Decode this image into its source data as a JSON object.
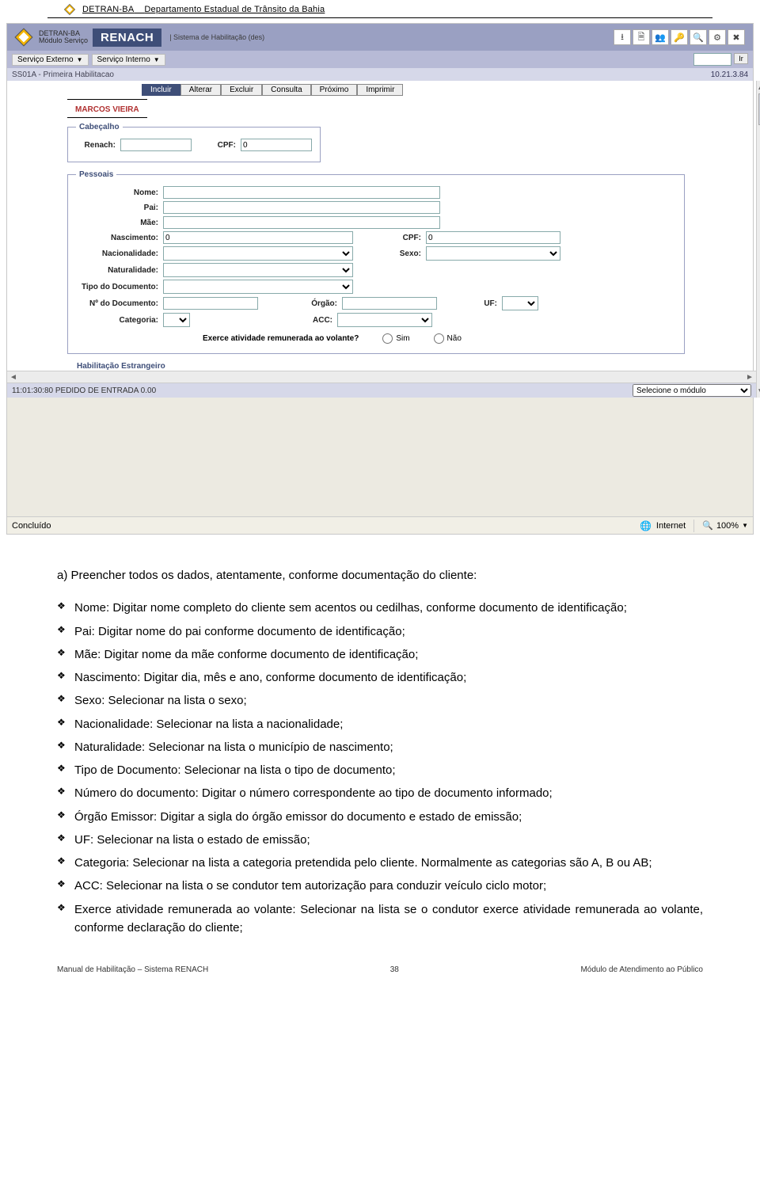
{
  "header": {
    "org_short": "DETRAN-BA",
    "org_long": "Departamento Estadual de Trânsito da Bahia"
  },
  "app": {
    "brand_top": "DETRAN-BA",
    "brand_sub": "Módulo Serviço",
    "system_name": "RENACH",
    "system_desc": "| Sistema de Habilitação (des)",
    "menu_ext": "Serviço Externo",
    "menu_int": "Serviço Interno",
    "goto_label": "Ir",
    "breadcrumb": "SS01A - Primeira Habilitacao",
    "version": "10.21.3.84",
    "toolbar": {
      "incluir": "Incluir",
      "alterar": "Alterar",
      "excluir": "Excluir",
      "consulta": "Consulta",
      "proximo": "Próximo",
      "imprimir": "Imprimir"
    },
    "username": "MARCOS VIEIRA",
    "fieldsets": {
      "cabecalho": {
        "legend": "Cabeçalho",
        "renach": "Renach:",
        "cpf": "CPF:",
        "cpf_value": "0"
      },
      "pessoais": {
        "legend": "Pessoais",
        "nome": "Nome:",
        "pai": "Pai:",
        "mae": "Mãe:",
        "nascimento": "Nascimento:",
        "nasc_value": "0",
        "cpf": "CPF:",
        "cpf_value": "0",
        "nacionalidade": "Nacionalidade:",
        "sexo": "Sexo:",
        "naturalidade": "Naturalidade:",
        "tipo_doc": "Tipo do Documento:",
        "num_doc": "Nº do Documento:",
        "orgao": "Órgão:",
        "uf": "UF:",
        "categoria": "Categoria:",
        "acc": "ACC:",
        "remun_q": "Exerce atividade remunerada ao volante?",
        "sim": "Sim",
        "nao": "Não"
      },
      "hab_estrang": "Habilitação Estrangeiro"
    },
    "status_time": "11:01:30:80 PEDIDO DE ENTRADA 0.00",
    "module_placeholder": "Selecione o módulo"
  },
  "ie_status": {
    "left": "Concluído",
    "zone": "Internet",
    "zoom": "100%"
  },
  "doc": {
    "lead": "a) Preencher todos os dados, atentamente, conforme documentação do cliente:",
    "items": [
      "Nome: Digitar nome completo do cliente sem acentos ou cedilhas, conforme documento de identificação;",
      "Pai: Digitar nome do pai conforme documento de identificação;",
      "Mãe: Digitar nome da mãe conforme documento de identificação;",
      "Nascimento: Digitar dia, mês e ano, conforme documento de identificação;",
      "Sexo: Selecionar na lista o sexo;",
      "Nacionalidade: Selecionar na lista a nacionalidade;",
      "Naturalidade: Selecionar na lista o município de nascimento;",
      "Tipo de Documento: Selecionar na lista o tipo de documento;",
      "Número do documento: Digitar o número correspondente ao tipo de documento informado;",
      "Órgão Emissor: Digitar a sigla do órgão emissor do documento e estado de emissão;",
      "UF: Selecionar na lista o estado de emissão;",
      "Categoria: Selecionar na lista a categoria pretendida pelo cliente. Normalmente as categorias são A, B ou AB;",
      "ACC: Selecionar na lista o se condutor tem autorização para conduzir veículo ciclo motor;",
      "Exerce atividade remunerada ao volante: Selecionar na lista se o condutor exerce atividade remunerada ao volante, conforme declaração do cliente;"
    ]
  },
  "footer": {
    "left": "Manual de Habilitação – Sistema RENACH",
    "page": "38",
    "right": "Módulo de Atendimento ao Público"
  }
}
